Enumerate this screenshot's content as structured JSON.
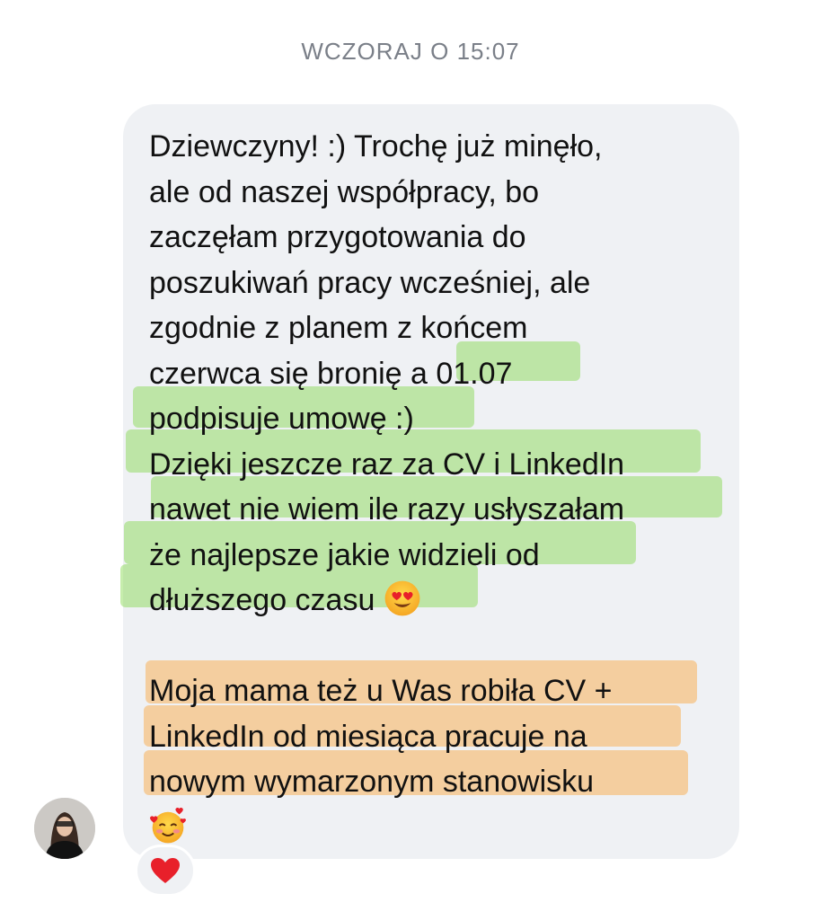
{
  "header": {
    "timestamp": "WCZORAJ O 15:07"
  },
  "message": {
    "lines": [
      "Dziewczyny! :) Trochę już minęło,",
      "ale od naszej współpracy, bo",
      "zaczęłam przygotowania do",
      "poszukiwań pracy wcześniej, ale",
      "zgodnie z planem z końcem",
      "czerwca się bronię a 01.07",
      "podpisuje umowę :)",
      "Dzięki jeszcze raz za CV i LinkedIn",
      "nawet nie wiem ile razy usłyszałam",
      "że najlepsze jakie widzieli od",
      "dłuższego czasu",
      "",
      "Moja mama też u Was robiła CV +",
      "LinkedIn od miesiąca pracuje na",
      "nowym wymarzonym stanowisku"
    ],
    "emoji_heart_eyes": "heart-eyes-emoji",
    "emoji_smiling_hearts": "smiling-face-with-hearts-emoji"
  },
  "reaction": {
    "icon": "red-heart-icon"
  },
  "sender": {
    "avatar": "user-avatar-photo"
  },
  "colors": {
    "bubble": "#eff1f4",
    "highlight_green": "#80d646",
    "highlight_orange": "#f7b05a",
    "heart": "#e8202a",
    "timestamp": "#7a7f88"
  }
}
